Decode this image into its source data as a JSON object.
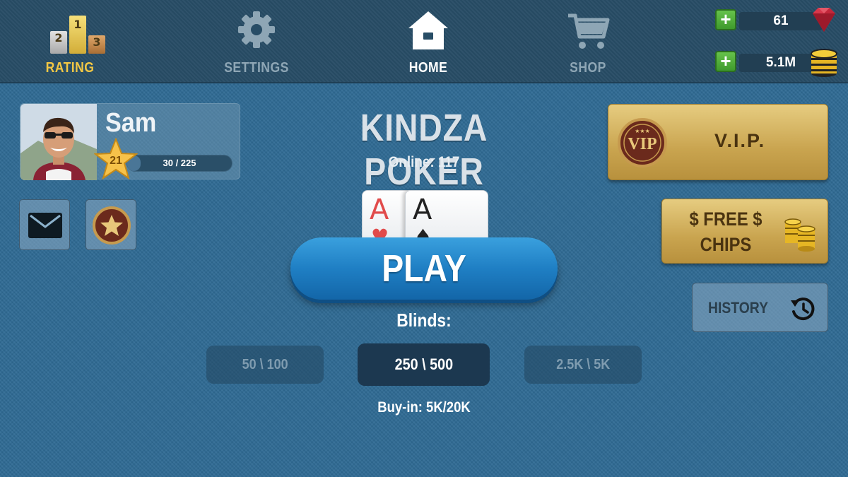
{
  "nav": {
    "rating": {
      "label": "RATING",
      "podium": [
        "2",
        "1",
        "3"
      ]
    },
    "settings": {
      "label": "SETTINGS"
    },
    "home": {
      "label": "HOME"
    },
    "shop": {
      "label": "SHOP"
    }
  },
  "currency": {
    "gems": {
      "amount": "61",
      "icon": "gem-icon",
      "add_icon": "plus-icon"
    },
    "chips": {
      "amount": "5.1M",
      "icon": "chip-stack-icon",
      "add_icon": "plus-icon"
    }
  },
  "profile": {
    "name": "Sam",
    "level": "21",
    "xp_text": "30 / 225",
    "xp_fraction": 0.13
  },
  "side_buttons": {
    "mail_icon": "envelope-icon",
    "favorites_icon": "star-badge-icon"
  },
  "lobby": {
    "title": "KINDZA POKER",
    "online": "Online: 117",
    "cards": [
      {
        "rank": "A",
        "suit": "♥"
      },
      {
        "rank": "A",
        "suit": "♠"
      }
    ],
    "play_label": "PLAY",
    "blinds_label": "Blinds:",
    "blind_options": [
      {
        "label": "50 \\ 100",
        "selected": false
      },
      {
        "label": "250 \\ 500",
        "selected": true
      },
      {
        "label": "2.5K \\ 5K",
        "selected": false
      }
    ],
    "buyin": "Buy-in: 5K/20K"
  },
  "right_panel": {
    "vip": {
      "badge_text": "VIP",
      "label": "V.I.P."
    },
    "free_chips": {
      "line1": "$ FREE $",
      "line2": "CHIPS"
    },
    "history": {
      "label": "HISTORY"
    }
  },
  "colors": {
    "felt": "#2f6b94",
    "topbar": "#284d66",
    "play_blue": "#1f7fc4",
    "gold": "#c9a44f",
    "rating_accent": "#f2c744",
    "plus_green": "#4fae38"
  }
}
